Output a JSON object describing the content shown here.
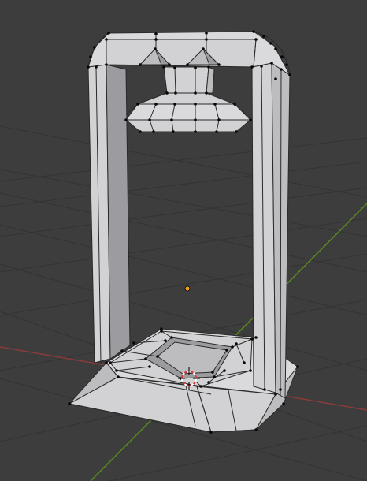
{
  "viewport": {
    "background": "#3d3d3d",
    "grid_color": "#353535",
    "x_axis_color": "#8c3a3a",
    "y_axis_color": "#5c8a1e",
    "mesh_color": "#d2d2d4",
    "vertex_color": "#000000",
    "origin_color": "#f0a020",
    "cursor_colors": [
      "#e03030",
      "#ffffff"
    ]
  },
  "icons": {
    "origin": "object-origin-icon",
    "cursor": "3d-cursor-icon"
  }
}
